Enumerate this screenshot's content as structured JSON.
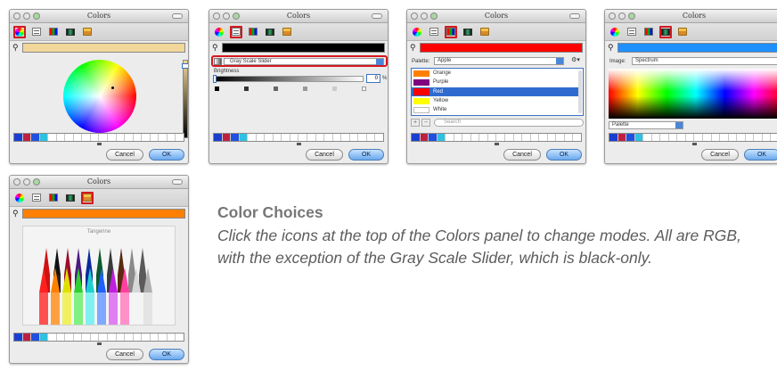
{
  "panel_title": "Colors",
  "caption": {
    "title": "Color Choices",
    "body": "Click the icons at the top of the Colors panel to change modes. All are RGB, with the exception of the Gray Scale Slider, which is black-only."
  },
  "buttons": {
    "cancel": "Cancel",
    "ok": "OK"
  },
  "toolbar_icons": [
    "color-wheel-icon",
    "color-sliders-icon",
    "color-palettes-icon",
    "image-palettes-icon",
    "crayons-icon"
  ],
  "panels": {
    "wheel": {
      "mode": "Color Wheel",
      "color": "#f1d79a"
    },
    "sliders": {
      "mode": "Gray Scale Slider",
      "color": "#000000",
      "brightness_label": "Brightness",
      "brightness_value": "0",
      "brightness_unit": "%"
    },
    "palettes": {
      "mode": "Color Palettes",
      "color": "#ff0000",
      "palette_label": "Palette:",
      "palette_value": "Apple",
      "search_placeholder": "Search",
      "items": [
        {
          "name": "Orange",
          "color": "#ff8000"
        },
        {
          "name": "Purple",
          "color": "#800080"
        },
        {
          "name": "Red",
          "color": "#ff0000"
        },
        {
          "name": "Yellow",
          "color": "#ffff00"
        },
        {
          "name": "White",
          "color": "#ffffff"
        }
      ],
      "selected_index": 2
    },
    "spectrum": {
      "mode": "Image Palettes",
      "color": "#1e90ff",
      "image_label": "Image:",
      "image_value": "Spectrum",
      "menu_value": "Palette"
    },
    "crayons": {
      "mode": "Crayons",
      "color": "#ff8000",
      "selected_name": "Tangerine"
    }
  },
  "swatch_strip": [
    "#1a3fd0",
    "#c02040",
    "#2050e0",
    "#30c0e0",
    "#ffffff",
    "#ffffff",
    "#ffffff",
    "#ffffff",
    "#ffffff",
    "#ffffff",
    "#ffffff",
    "#ffffff",
    "#ffffff",
    "#ffffff",
    "#ffffff",
    "#ffffff",
    "#ffffff",
    "#ffffff",
    "#ffffff",
    "#ffffff"
  ]
}
